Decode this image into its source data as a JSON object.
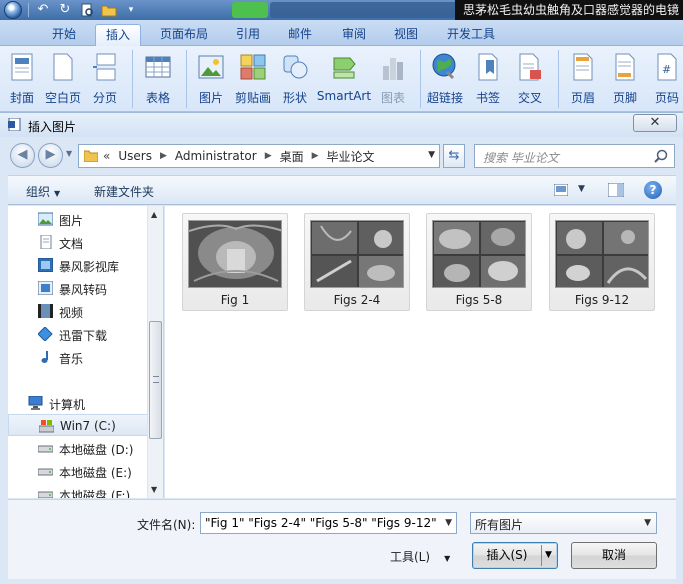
{
  "window": {
    "title": "思茅松毛虫幼虫触角及口器感觉器的电镜"
  },
  "ribbon": {
    "tabs": [
      {
        "label": "开始"
      },
      {
        "label": "插入",
        "active": true
      },
      {
        "label": "页面布局"
      },
      {
        "label": "引用"
      },
      {
        "label": "邮件"
      },
      {
        "label": "审阅"
      },
      {
        "label": "视图"
      },
      {
        "label": "开发工具"
      }
    ],
    "buttons": {
      "cover": "封面",
      "blank_page": "空白页",
      "page_break": "分页",
      "table": "表格",
      "picture": "图片",
      "clipart": "剪贴画",
      "shapes": "形状",
      "smartart": "SmartArt",
      "chart": "图表",
      "hyperlink": "超链接",
      "bookmark": "书签",
      "cross_ref": "交叉",
      "header": "页眉",
      "footer": "页脚",
      "page_number": "页码"
    }
  },
  "dialog": {
    "title": "插入图片",
    "close_label": "✕",
    "address": {
      "overflow": "«",
      "crumbs": [
        "Users",
        "Administrator",
        "桌面",
        "毕业论文"
      ]
    },
    "search_placeholder": "搜索 毕业论文",
    "toolbar": {
      "organize": "组织",
      "new_folder": "新建文件夹",
      "help": "?"
    },
    "nav_items": [
      {
        "label": "图片",
        "icon": "pictures-icon"
      },
      {
        "label": "文档",
        "icon": "documents-icon"
      },
      {
        "label": "暴风影视库",
        "icon": "video-library-icon"
      },
      {
        "label": "暴风转码",
        "icon": "transcode-icon"
      },
      {
        "label": "视频",
        "icon": "videos-icon"
      },
      {
        "label": "迅雷下载",
        "icon": "download-icon"
      },
      {
        "label": "音乐",
        "icon": "music-icon"
      },
      {
        "label": "计算机",
        "icon": "computer-icon"
      },
      {
        "label": "Win7 (C:)",
        "icon": "system-drive-icon",
        "selected": true
      },
      {
        "label": "本地磁盘 (D:)",
        "icon": "drive-icon"
      },
      {
        "label": "本地磁盘 (E:)",
        "icon": "drive-icon"
      },
      {
        "label": "本地磁盘 (F:)",
        "icon": "drive-icon"
      }
    ],
    "files": [
      {
        "name": "Fig 1"
      },
      {
        "name": "Figs 2-4"
      },
      {
        "name": "Figs 5-8"
      },
      {
        "name": "Figs 9-12"
      }
    ],
    "filename_label": "文件名(N):",
    "filename_value": "\"Fig 1\" \"Figs 2-4\" \"Figs 5-8\" \"Figs 9-12\"",
    "filter_value": "所有图片",
    "tools_label": "工具(L)",
    "insert_label": "插入(S)",
    "cancel_label": "取消"
  }
}
